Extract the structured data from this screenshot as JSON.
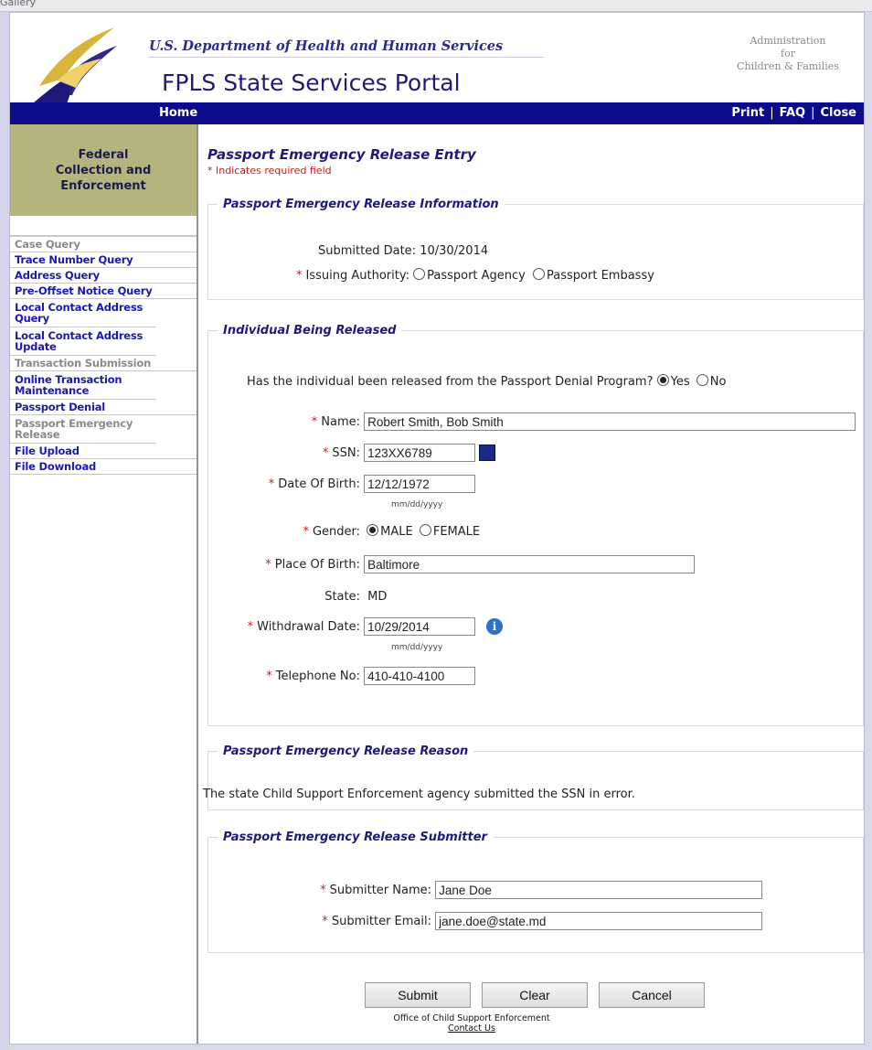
{
  "window": {
    "title": "Gallery"
  },
  "header": {
    "department": "U.S. Department of Health and Human Services",
    "portal_title": "FPLS State Services Portal",
    "agency_line1": "Administration",
    "agency_line2": "for",
    "agency_line3": "Children & Families"
  },
  "nav": {
    "home": "Home",
    "print": "Print",
    "faq": "FAQ",
    "close": "Close",
    "separator": "|"
  },
  "sidebar": {
    "heading": "Federal Collection and Enforcement",
    "items": [
      {
        "label": "Case Query",
        "dim": true
      },
      {
        "label": "Trace Number Query",
        "dim": false
      },
      {
        "label": "Address Query",
        "dim": false
      },
      {
        "label": "Pre-Offset Notice Query",
        "dim": false
      },
      {
        "label": "Local Contact Address Query",
        "dim": false
      },
      {
        "label": "Local Contact Address Update",
        "dim": false
      },
      {
        "label": "Transaction Submission",
        "dim": true
      },
      {
        "label": "Online Transaction Maintenance",
        "dim": false
      },
      {
        "label": "Passport Denial",
        "dim": false
      },
      {
        "label": "Passport Emergency Release",
        "dim": true
      },
      {
        "label": "File Upload",
        "dim": false
      },
      {
        "label": "File Download",
        "dim": false
      }
    ]
  },
  "page": {
    "title": "Passport Emergency Release Entry",
    "required_note": "* Indicates required field",
    "required_mark": "*"
  },
  "info_section": {
    "legend": "Passport Emergency Release Information",
    "submitted_label": "Submitted Date:",
    "submitted_value": "10/30/2014",
    "authority_label": "Issuing Authority:",
    "authority_options": [
      "Passport Agency",
      "Passport Embassy"
    ],
    "authority_selected": null
  },
  "individual": {
    "legend": "Individual Being Released",
    "released_question": "Has the individual been released from the Passport Denial Program?",
    "released_yes": "Yes",
    "released_no": "No",
    "released_selected": "Yes",
    "name_label": "Name:",
    "name_value": "Robert Smith, Bob Smith",
    "ssn_label": "SSN:",
    "ssn_value": "123XX6789",
    "dob_label": "Date Of Birth:",
    "dob_value": "12/12/1972",
    "date_format": "mm/dd/yyyy",
    "gender_label": "Gender:",
    "gender_male": "MALE",
    "gender_female": "FEMALE",
    "gender_selected": "MALE",
    "pob_label": "Place Of Birth:",
    "pob_value": "Baltimore",
    "state_label": "State:",
    "state_value": "MD",
    "withdrawal_label": "Withdrawal Date:",
    "withdrawal_value": "10/29/2014",
    "phone_label": "Telephone No:",
    "phone_value": "410-410-4100"
  },
  "reason": {
    "legend": "Passport Emergency Release Reason",
    "text": "The state Child Support Enforcement agency submitted the SSN in error."
  },
  "submitter": {
    "legend": "Passport Emergency Release Submitter",
    "name_label": "Submitter Name:",
    "name_value": "Jane Doe",
    "email_label": "Submitter Email:",
    "email_value": "jane.doe@state.md"
  },
  "buttons": {
    "submit": "Submit",
    "clear": "Clear",
    "cancel": "Cancel"
  },
  "footer": {
    "office": "Office of Child Support Enforcement",
    "contact": "Contact Us"
  }
}
